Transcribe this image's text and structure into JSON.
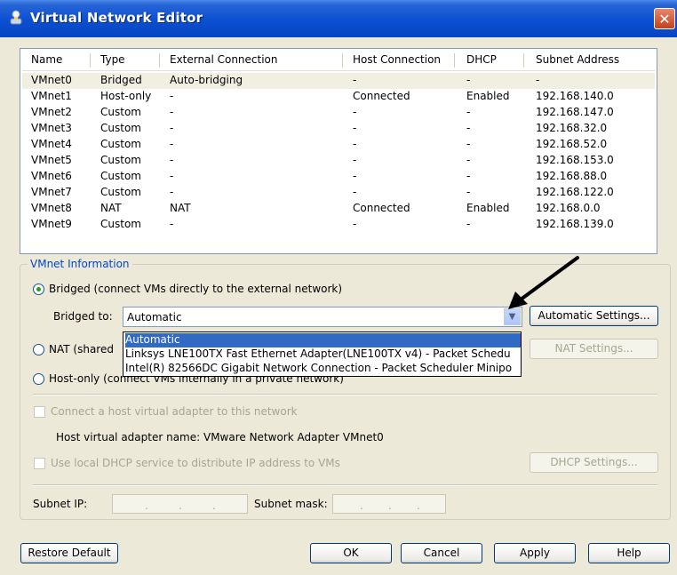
{
  "window": {
    "title": "Virtual Network Editor",
    "close_glyph": "✕"
  },
  "network_list": {
    "headers": [
      "Name",
      "Type",
      "External Connection",
      "Host Connection",
      "DHCP",
      "Subnet Address"
    ],
    "rows": [
      [
        "VMnet0",
        "Bridged",
        "Auto-bridging",
        "-",
        "-",
        "-"
      ],
      [
        "VMnet1",
        "Host-only",
        "-",
        "Connected",
        "Enabled",
        "192.168.140.0"
      ],
      [
        "VMnet2",
        "Custom",
        "-",
        "-",
        "-",
        "192.168.147.0"
      ],
      [
        "VMnet3",
        "Custom",
        "-",
        "-",
        "-",
        "192.168.32.0"
      ],
      [
        "VMnet4",
        "Custom",
        "-",
        "-",
        "-",
        "192.168.52.0"
      ],
      [
        "VMnet5",
        "Custom",
        "-",
        "-",
        "-",
        "192.168.153.0"
      ],
      [
        "VMnet6",
        "Custom",
        "-",
        "-",
        "-",
        "192.168.88.0"
      ],
      [
        "VMnet7",
        "Custom",
        "-",
        "-",
        "-",
        "192.168.122.0"
      ],
      [
        "VMnet8",
        "NAT",
        "NAT",
        "Connected",
        "Enabled",
        "192.168.0.0"
      ],
      [
        "VMnet9",
        "Custom",
        "-",
        "-",
        "-",
        "192.168.139.0"
      ]
    ],
    "selected_row": 0
  },
  "vmnet_info": {
    "group_label": "VMnet Information",
    "bridged_label": "Bridged (connect VMs directly to the external network)",
    "bridged_to_label": "Bridged to:",
    "bridged_to_value": "Automatic",
    "automatic_settings_button": "Automatic Settings...",
    "dropdown_options": [
      "Automatic",
      "Linksys LNE100TX Fast Ethernet Adapter(LNE100TX v4) - Packet Schedu",
      "Intel(R) 82566DC Gigabit Network Connection - Packet Scheduler Minipo"
    ],
    "nat_label": "NAT (shared",
    "nat_settings_button": "NAT Settings...",
    "hostonly_label": "Host-only (connect VMs internally in a private network)",
    "connect_adapter_label": "Connect a host virtual adapter to this network",
    "host_adapter_name": "Host virtual adapter name: VMware Network Adapter VMnet0",
    "dhcp_label": "Use local DHCP service to distribute IP address to VMs",
    "dhcp_settings_button": "DHCP Settings...",
    "subnet_ip_label": "Subnet IP:",
    "subnet_mask_label": "Subnet mask:"
  },
  "footer": {
    "restore_default": "Restore Default",
    "ok": "OK",
    "cancel": "Cancel",
    "apply": "Apply",
    "help": "Help"
  },
  "colors": {
    "titlebar_blue": "#0a4fd0",
    "selection_blue": "#316ac5",
    "group_label_blue": "#0046d5",
    "dialog_bg": "#ECE9D8"
  },
  "icons": [
    "network-app-icon",
    "close-icon",
    "combo-arrow-icon",
    "annotation-arrow"
  ]
}
